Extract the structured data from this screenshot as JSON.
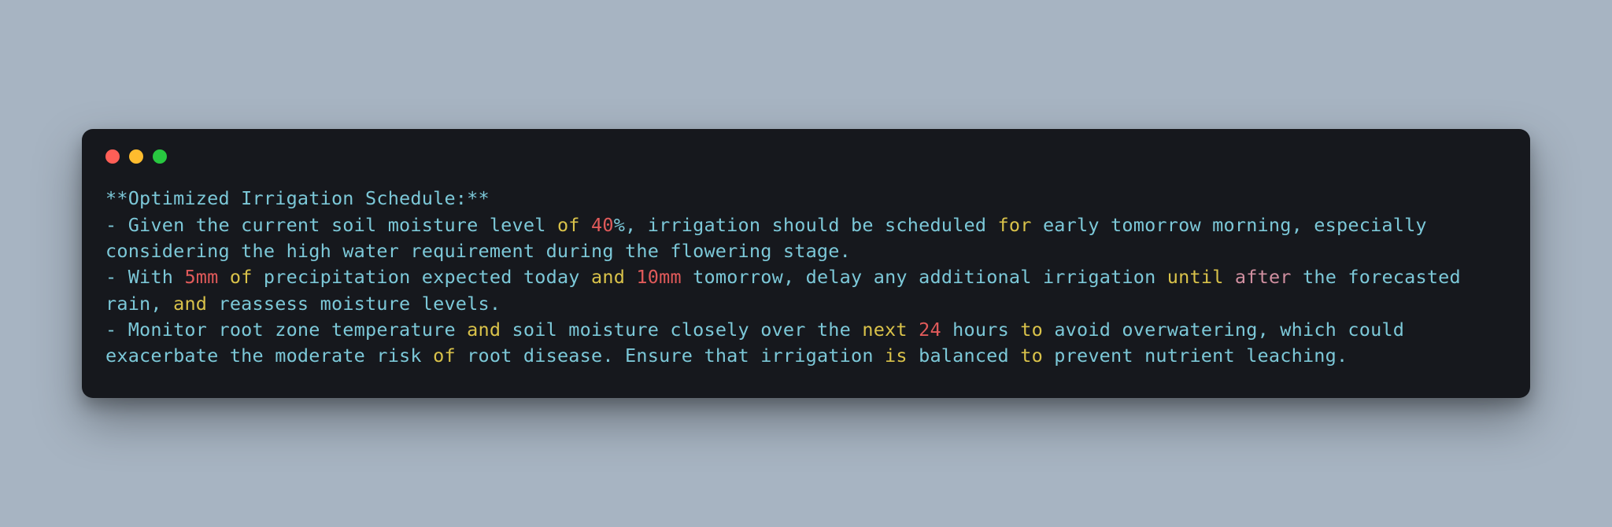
{
  "colors": {
    "background": "#a7b4c2",
    "window": "#16181d",
    "trafficRed": "#ff5f57",
    "trafficYellow": "#febc2e",
    "trafficGreen": "#28c840",
    "tokenCyan": "#7cc8d8",
    "tokenYellow": "#d9c24a",
    "tokenRed": "#e05a5a",
    "tokenPink": "#d08fa0"
  },
  "tokens": [
    {
      "t": "**Optimized Irrigation Schedule:**",
      "c": "cyan"
    },
    {
      "t": "\n",
      "c": "cyan"
    },
    {
      "t": "- Given the current soil moisture level ",
      "c": "cyan"
    },
    {
      "t": "of",
      "c": "yellow"
    },
    {
      "t": " ",
      "c": "cyan"
    },
    {
      "t": "40",
      "c": "red"
    },
    {
      "t": "%, irrigation should be scheduled ",
      "c": "cyan"
    },
    {
      "t": "for",
      "c": "yellow"
    },
    {
      "t": " early tomorrow morning, especially considering the high water requirement during the flowering stage.",
      "c": "cyan"
    },
    {
      "t": "\n",
      "c": "cyan"
    },
    {
      "t": "- With ",
      "c": "cyan"
    },
    {
      "t": "5mm",
      "c": "red"
    },
    {
      "t": " ",
      "c": "cyan"
    },
    {
      "t": "of",
      "c": "yellow"
    },
    {
      "t": " precipitation expected today ",
      "c": "cyan"
    },
    {
      "t": "and",
      "c": "yellow"
    },
    {
      "t": " ",
      "c": "cyan"
    },
    {
      "t": "10mm",
      "c": "red"
    },
    {
      "t": " tomorrow, delay any additional irrigation ",
      "c": "cyan"
    },
    {
      "t": "until",
      "c": "yellow"
    },
    {
      "t": " ",
      "c": "cyan"
    },
    {
      "t": "after",
      "c": "pink"
    },
    {
      "t": " the forecasted rain, ",
      "c": "cyan"
    },
    {
      "t": "and",
      "c": "yellow"
    },
    {
      "t": " reassess moisture levels.",
      "c": "cyan"
    },
    {
      "t": "\n",
      "c": "cyan"
    },
    {
      "t": "- Monitor root zone temperature ",
      "c": "cyan"
    },
    {
      "t": "and",
      "c": "yellow"
    },
    {
      "t": " soil moisture closely over the ",
      "c": "cyan"
    },
    {
      "t": "next",
      "c": "yellow"
    },
    {
      "t": " ",
      "c": "cyan"
    },
    {
      "t": "24",
      "c": "red"
    },
    {
      "t": " hours ",
      "c": "cyan"
    },
    {
      "t": "to",
      "c": "yellow"
    },
    {
      "t": " avoid overwatering, which could exacerbate the moderate risk ",
      "c": "cyan"
    },
    {
      "t": "of",
      "c": "yellow"
    },
    {
      "t": " root disease. Ensure that irrigation ",
      "c": "cyan"
    },
    {
      "t": "is",
      "c": "yellow"
    },
    {
      "t": " balanced ",
      "c": "cyan"
    },
    {
      "t": "to",
      "c": "yellow"
    },
    {
      "t": " prevent nutrient leaching.",
      "c": "cyan"
    }
  ]
}
